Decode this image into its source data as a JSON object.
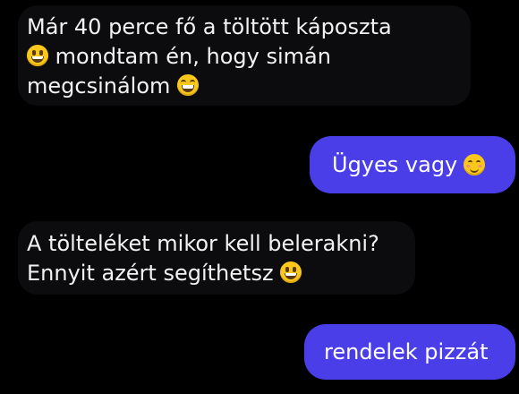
{
  "conversation": {
    "messages": [
      {
        "direction": "incoming",
        "lines": [
          "Már 40 perce fő a töltött káposzta",
          "mondtam én, hogy simán",
          "megcsinálom"
        ],
        "emojis": [
          "grinning-face",
          "grinning-squinting-face"
        ]
      },
      {
        "direction": "outgoing",
        "text": "Ügyes vagy",
        "emojis": [
          "smiling-face-with-smiling-eyes"
        ]
      },
      {
        "direction": "incoming",
        "lines": [
          "A tölteléket mikor kell belerakni?",
          "Ennyit azért segíthetsz"
        ],
        "emojis": [
          "grinning-face"
        ]
      },
      {
        "direction": "outgoing",
        "text": "rendelek pizzát",
        "emojis": []
      }
    ]
  },
  "colors": {
    "background": "#000000",
    "incoming_bubble": "#0c0c0e",
    "outgoing_bubble": "#4a3ee8",
    "text": "#ffffff",
    "emoji": "#f9c81b"
  }
}
